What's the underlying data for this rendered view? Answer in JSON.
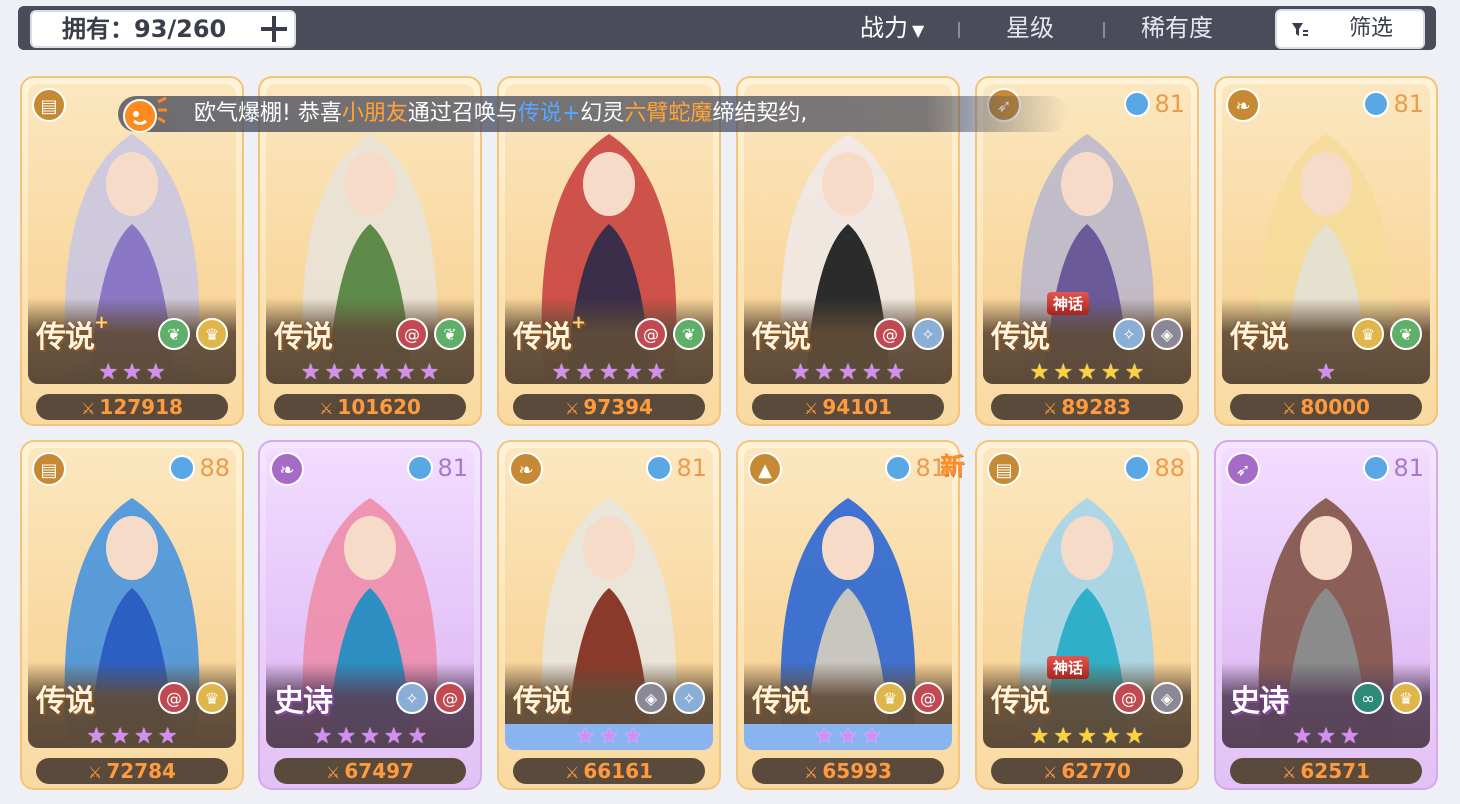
{
  "topbar": {
    "owned_label": "拥有：93/260",
    "sort_power": "战力",
    "sort_power_caret": "▼",
    "sort_star": "星级",
    "sort_rarity": "稀有度",
    "filter_label": "筛选"
  },
  "announcement": {
    "part1": "欧气爆棚!  恭喜",
    "player": "小朋友",
    "part2": "通过召唤与",
    "rarity": "传说+",
    "part3": "幻灵",
    "hero": "六臂蛇魔",
    "part4": "缔结契约,"
  },
  "new_tag": "新",
  "cards": [
    {
      "rarity": "传说",
      "plus": "+",
      "myth": "",
      "elements": [
        "nature",
        "light"
      ],
      "stars": 3,
      "star_color": "purple",
      "star_bg": "",
      "power": "127918",
      "class_icon": "book-icon",
      "level": "",
      "epic": false,
      "hero_colors": [
        "#c8c6e6",
        "#8a78c6"
      ]
    },
    {
      "rarity": "传说",
      "plus": "",
      "myth": "",
      "elements": [
        "spiral",
        "nature"
      ],
      "stars": 6,
      "star_color": "purple",
      "star_bg": "",
      "power": "101620",
      "class_icon": "",
      "level": "",
      "epic": false,
      "hero_colors": [
        "#e8e4da",
        "#5f8b4a"
      ]
    },
    {
      "rarity": "传说",
      "plus": "+",
      "myth": "",
      "elements": [
        "spiral",
        "nature"
      ],
      "stars": 5,
      "star_color": "purple",
      "star_bg": "",
      "power": "97394",
      "class_icon": "",
      "level": "",
      "epic": false,
      "hero_colors": [
        "#c63a3a",
        "#3a2e4a"
      ]
    },
    {
      "rarity": "传说",
      "plus": "",
      "myth": "",
      "elements": [
        "spiral",
        "ice"
      ],
      "stars": 5,
      "star_color": "purple",
      "star_bg": "",
      "power": "94101",
      "class_icon": "",
      "level": "",
      "epic": false,
      "hero_colors": [
        "#eeeaea",
        "#2b2b2b"
      ]
    },
    {
      "rarity": "传说",
      "plus": "",
      "myth": "神话",
      "elements": [
        "ice",
        "void"
      ],
      "stars": 5,
      "star_color": "gold",
      "star_bg": "",
      "power": "89283",
      "class_icon": "bow-icon",
      "level": "81",
      "epic": false,
      "hero_colors": [
        "#b9b6cf",
        "#6a5a9a"
      ]
    },
    {
      "rarity": "传说",
      "plus": "",
      "myth": "",
      "elements": [
        "light",
        "nature"
      ],
      "stars": 1,
      "star_color": "purple",
      "star_bg": "",
      "power": "80000",
      "class_icon": "wing-icon",
      "level": "81",
      "epic": false,
      "hero_colors": [
        "#f5dc9a",
        "#e6e0cf"
      ]
    },
    {
      "rarity": "传说",
      "plus": "",
      "myth": "",
      "elements": [
        "spiral",
        "light"
      ],
      "stars": 4,
      "star_color": "purple",
      "star_bg": "",
      "power": "72784",
      "class_icon": "book-icon",
      "level": "88",
      "epic": false,
      "hero_colors": [
        "#3d8fe0",
        "#2b5fc2"
      ]
    },
    {
      "rarity": "史诗",
      "plus": "",
      "myth": "",
      "elements": [
        "ice",
        "spiral"
      ],
      "stars": 5,
      "star_color": "purple",
      "star_bg": "",
      "power": "67497",
      "class_icon": "wing-icon",
      "level": "81",
      "epic": true,
      "hero_colors": [
        "#ef8aa6",
        "#2d8fc2"
      ]
    },
    {
      "rarity": "传说",
      "plus": "",
      "myth": "",
      "elements": [
        "void",
        "ice"
      ],
      "stars": 3,
      "star_color": "purple",
      "star_bg": "blue",
      "power": "66161",
      "class_icon": "wing-icon",
      "level": "81",
      "epic": false,
      "hero_colors": [
        "#e8e6e2",
        "#8a3a2a"
      ]
    },
    {
      "rarity": "传说",
      "plus": "",
      "myth": "",
      "elements": [
        "light",
        "spiral"
      ],
      "stars": 3,
      "star_color": "purple",
      "star_bg": "blue",
      "power": "65993",
      "class_icon": "helmet-icon",
      "level": "81",
      "epic": false,
      "hero_colors": [
        "#1f5fd6",
        "#c9c6c0"
      ]
    },
    {
      "rarity": "传说",
      "plus": "",
      "myth": "神话",
      "elements": [
        "spiral",
        "void"
      ],
      "stars": 5,
      "star_color": "gold",
      "star_bg": "",
      "power": "62770",
      "class_icon": "book-icon",
      "level": "88",
      "epic": false,
      "hero_colors": [
        "#9fd4ef",
        "#2fb0c8"
      ]
    },
    {
      "rarity": "史诗",
      "plus": "",
      "myth": "",
      "elements": [
        "chaos",
        "light"
      ],
      "stars": 3,
      "star_color": "purple",
      "star_bg": "",
      "power": "62571",
      "class_icon": "bow-icon",
      "level": "81",
      "epic": true,
      "hero_colors": [
        "#7a4b3a",
        "#8b8b8b"
      ]
    }
  ]
}
